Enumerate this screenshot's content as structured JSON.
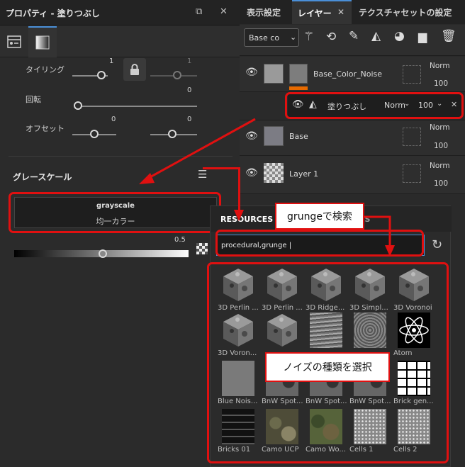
{
  "properties": {
    "title": "プロパティ - 塗りつぶし",
    "tiling_label": "タイリング",
    "tiling_val1": "1",
    "tiling_val2": "1",
    "rotation_label": "回転",
    "rotation_val": "0",
    "offset_label": "オフセット",
    "offset_val1": "0",
    "offset_val2": "0",
    "grayscale_section": "グレースケール",
    "grayscale_name": "grayscale",
    "grayscale_sub": "均一カラー",
    "gray_value": "0.5"
  },
  "tabs": {
    "display": "表示設定",
    "layer": "レイヤー",
    "texture": "テクスチャセットの設定"
  },
  "toolbar": {
    "basecolor": "Base co"
  },
  "layers": [
    {
      "name": "Base_Color_Noise",
      "blend": "Norm",
      "opacity": "100"
    },
    {
      "name": "塗りつぶし",
      "blend": "Norm",
      "opacity": "100"
    },
    {
      "name": "Base",
      "blend": "Norm",
      "opacity": "100"
    },
    {
      "name": "Layer 1",
      "blend": "Norm",
      "opacity": "100"
    }
  ],
  "resources": {
    "tab": "RESOURCES",
    "tab2": "TS",
    "search": "procedural,grunge |",
    "items": [
      "3D Perlin ...",
      "3D Perlin ...",
      "3D Ridge...",
      "3D Simpl...",
      "3D Voronoi",
      "3D Voron...",
      "",
      "",
      "",
      "Atom",
      "Blue Nois...",
      "BnW Spot...",
      "BnW Spot...",
      "BnW Spot...",
      "Brick gen...",
      "Bricks 01",
      "Camo UCP",
      "Camo Wo...",
      "Cells 1",
      "Cells 2"
    ]
  },
  "callouts": {
    "search": "grungeで検索",
    "select": "ノイズの種類を選択"
  }
}
